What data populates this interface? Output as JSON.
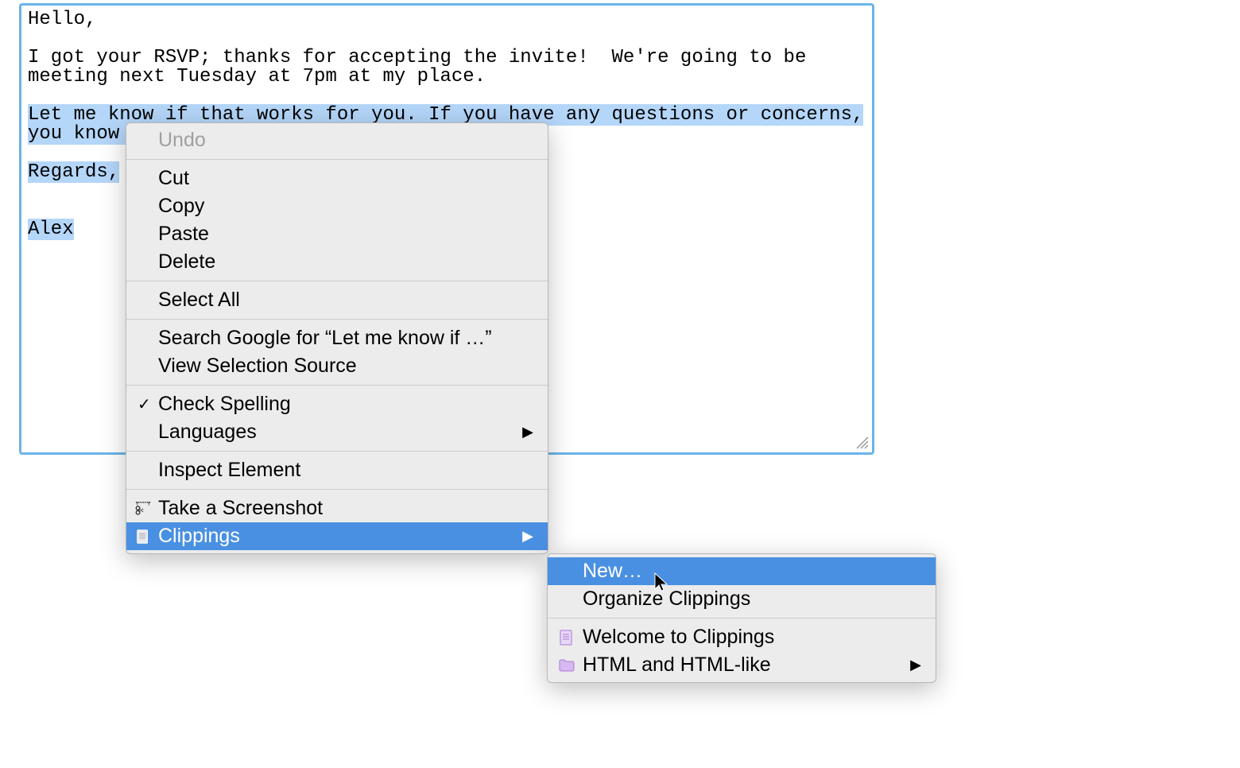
{
  "textarea": {
    "lines": [
      "Hello,",
      "",
      "I got your RSVP; thanks for accepting the invite!  We're going to be",
      "meeting next Tuesday at 7pm at my place.",
      "",
      "Let me know if that works for you. If you have any questions or concerns,",
      "you know ",
      "",
      "Regards,",
      "",
      "",
      "Alex"
    ],
    "selection_start_line": 5
  },
  "context_menu": {
    "items": [
      {
        "label": "Undo",
        "disabled": true
      },
      {
        "separator": true
      },
      {
        "label": "Cut"
      },
      {
        "label": "Copy"
      },
      {
        "label": "Paste"
      },
      {
        "label": "Delete"
      },
      {
        "separator": true
      },
      {
        "label": "Select All"
      },
      {
        "separator": true
      },
      {
        "label": "Search Google for “Let me know if …”"
      },
      {
        "label": "View Selection Source"
      },
      {
        "separator": true
      },
      {
        "label": "Check Spelling",
        "checked": true
      },
      {
        "label": "Languages",
        "has_submenu": true
      },
      {
        "separator": true
      },
      {
        "label": "Inspect Element"
      },
      {
        "separator": true
      },
      {
        "label": "Take a Screenshot",
        "icon": "screenshot"
      },
      {
        "label": "Clippings",
        "icon": "clippings",
        "has_submenu": true,
        "highlighted": true
      }
    ]
  },
  "submenu": {
    "items": [
      {
        "label": "New…",
        "highlighted": true
      },
      {
        "label": "Organize Clippings"
      },
      {
        "separator": true
      },
      {
        "label": "Welcome to Clippings",
        "icon": "note"
      },
      {
        "label": "HTML and HTML-like",
        "icon": "folder",
        "has_submenu": true
      }
    ]
  }
}
